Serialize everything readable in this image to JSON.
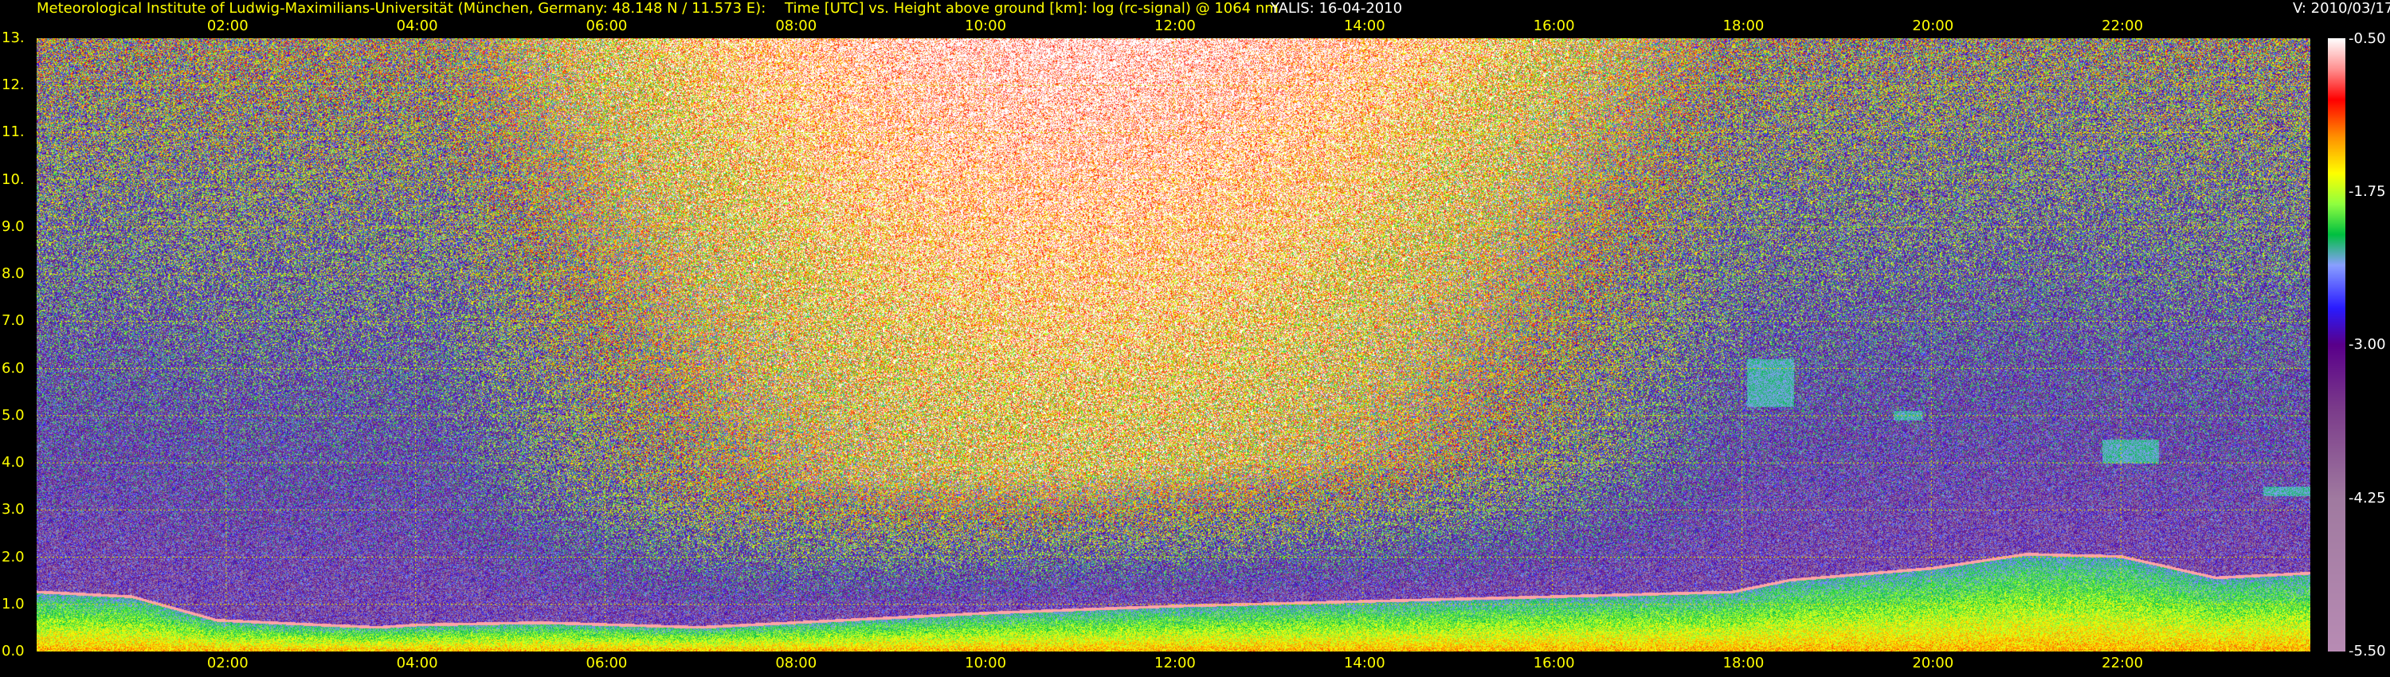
{
  "header": {
    "institute": "Meteorological Institute of Ludwig-Maximilians-Universität (München, Germany: 48.148 N / 11.573 E):",
    "plot_title": "Time [UTC] vs. Height above ground [km]: log (rc-signal) @ 1064 nm",
    "instrument": "YALIS: 16-04-2010",
    "version": "V: 2010/03/17"
  },
  "colors": {
    "text_yellow": "#ffff00",
    "text_white": "#ffffff",
    "background": "#000000",
    "grid": "#d6d600"
  },
  "chart_data": {
    "type": "heatmap",
    "title": "Time [UTC] vs. Height above ground [km]: log (rc-signal) @ 1064 nm",
    "x_unit": "UTC hour",
    "xlim": [
      0,
      24
    ],
    "x_ticks": [
      2,
      4,
      6,
      8,
      10,
      12,
      14,
      16,
      18,
      20,
      22
    ],
    "x_tick_labels": [
      "02:00",
      "04:00",
      "06:00",
      "08:00",
      "10:00",
      "12:00",
      "14:00",
      "16:00",
      "18:00",
      "20:00",
      "22:00"
    ],
    "y_unit": "km",
    "ylim": [
      0,
      13
    ],
    "y_ticks": [
      0,
      1,
      2,
      3,
      4,
      5,
      6,
      7,
      8,
      9,
      10,
      11,
      12,
      13
    ],
    "y_tick_labels": [
      "0.0",
      "1.0",
      "2.0",
      "3.0",
      "4.0",
      "5.0",
      "6.0",
      "7.0",
      "8.0",
      "9.0",
      "10.",
      "11.",
      "12.",
      "13."
    ],
    "grid": true,
    "colorbar": {
      "range": [
        -5.5,
        -0.5
      ],
      "ticks": [
        -5.5,
        -4.25,
        -3.0,
        -1.75,
        -0.5
      ],
      "tick_labels": [
        "-5.50",
        "-4.25",
        "-3.00",
        "-1.75",
        "-0.50"
      ],
      "stops": [
        {
          "value": -5.5,
          "color": "#b88cb4"
        },
        {
          "value": -4.25,
          "color": "#a07aa0"
        },
        {
          "value": -3.5,
          "color": "#7a3a8a"
        },
        {
          "value": -3.0,
          "color": "#5a008a"
        },
        {
          "value": -2.7,
          "color": "#2a1cff"
        },
        {
          "value": -2.35,
          "color": "#8aa0ff"
        },
        {
          "value": -2.1,
          "color": "#00c040"
        },
        {
          "value": -1.85,
          "color": "#90ff40"
        },
        {
          "value": -1.6,
          "color": "#ffff00"
        },
        {
          "value": -1.3,
          "color": "#ff9000"
        },
        {
          "value": -1.0,
          "color": "#ff0000"
        },
        {
          "value": -0.75,
          "color": "#ff9090"
        },
        {
          "value": -0.5,
          "color": "#ffffff"
        }
      ]
    },
    "features": {
      "boundary_layer_top_km": [
        {
          "t": 0.0,
          "h": 1.3
        },
        {
          "t": 1.0,
          "h": 1.2
        },
        {
          "t": 1.9,
          "h": 0.7
        },
        {
          "t": 3.0,
          "h": 0.6
        },
        {
          "t": 3.6,
          "h": 0.55
        },
        {
          "t": 4.0,
          "h": 0.6
        },
        {
          "t": 5.3,
          "h": 0.65
        },
        {
          "t": 7.0,
          "h": 0.55
        },
        {
          "t": 8.5,
          "h": 0.7
        },
        {
          "t": 10.0,
          "h": 0.85
        },
        {
          "t": 12.0,
          "h": 1.0
        },
        {
          "t": 14.0,
          "h": 1.1
        },
        {
          "t": 16.0,
          "h": 1.2
        },
        {
          "t": 17.9,
          "h": 1.3
        },
        {
          "t": 18.5,
          "h": 1.55
        },
        {
          "t": 20.0,
          "h": 1.8
        },
        {
          "t": 21.0,
          "h": 2.1
        },
        {
          "t": 22.0,
          "h": 2.05
        },
        {
          "t": 23.0,
          "h": 1.6
        },
        {
          "t": 24.0,
          "h": 1.7
        }
      ],
      "elevated_layers": [
        {
          "t_start": 18.05,
          "t_end": 18.55,
          "h_bottom": 5.2,
          "h_top": 6.2
        },
        {
          "t_start": 19.6,
          "t_end": 19.9,
          "h_bottom": 4.9,
          "h_top": 5.1
        },
        {
          "t_start": 21.8,
          "t_end": 22.4,
          "h_bottom": 4.0,
          "h_top": 4.5
        },
        {
          "t_start": 23.5,
          "t_end": 24.0,
          "h_bottom": 3.3,
          "h_top": 3.5
        }
      ]
    }
  }
}
